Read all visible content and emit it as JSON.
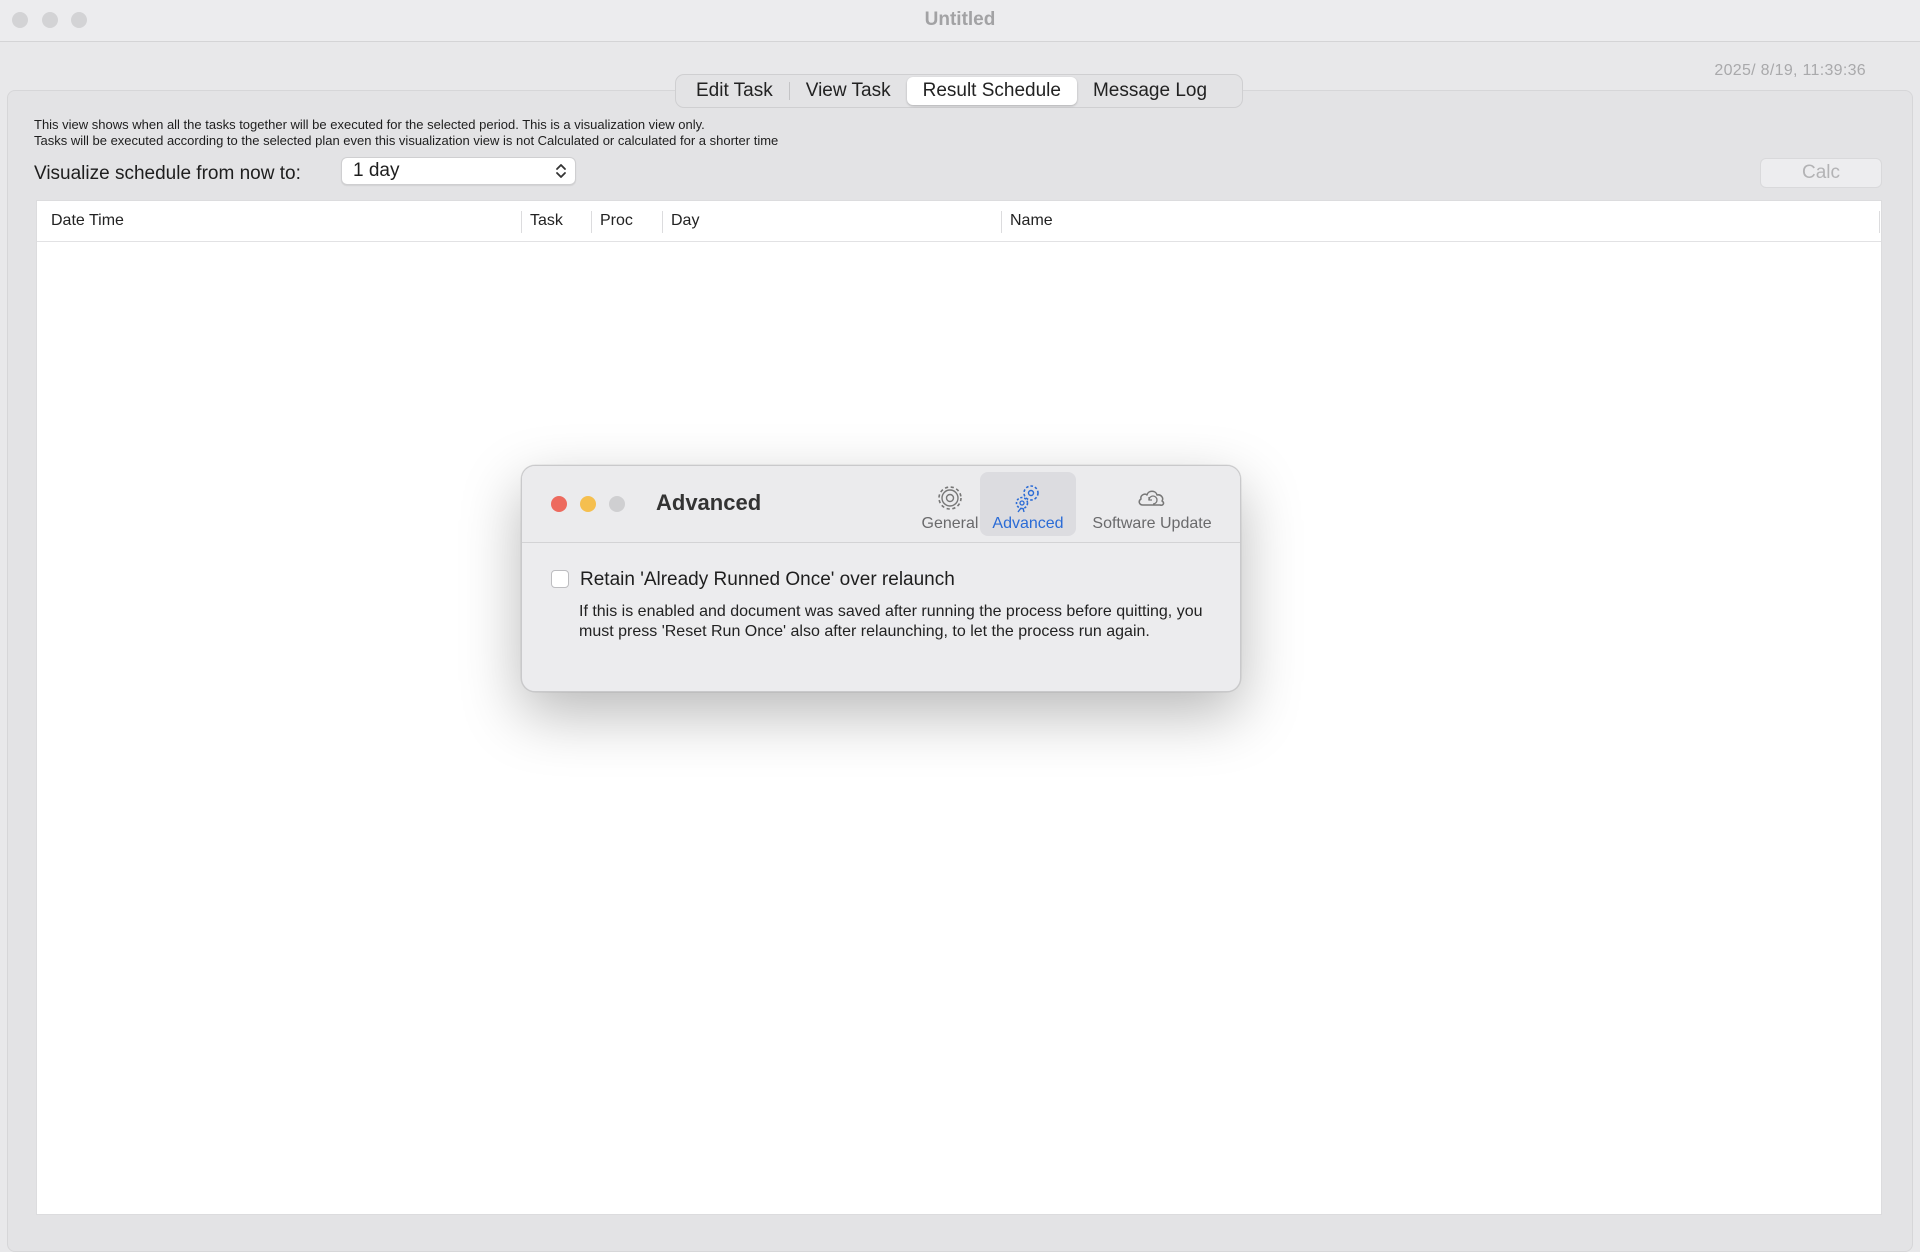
{
  "window": {
    "title": "Untitled",
    "datetime": "2025/  8/19, 11:39:36"
  },
  "tabs": [
    {
      "label": "Edit Task"
    },
    {
      "label": "View Task"
    },
    {
      "label": "Result Schedule",
      "active": true
    },
    {
      "label": "Message Log"
    }
  ],
  "description": {
    "line1": "This view shows when all the tasks together will be executed for the selected period. This is a visualization view only.",
    "line2": "Tasks will be executed according to the selected plan even this visualization view is not Calculated or calculated for a shorter time"
  },
  "visualize": {
    "label": "Visualize schedule from now to:",
    "selected": "1 day"
  },
  "calc_label": "Calc",
  "table": {
    "columns": [
      "Date Time",
      "Task",
      "Proc",
      "Day",
      "Name"
    ],
    "rows": []
  },
  "dialog": {
    "title": "Advanced",
    "tabs": [
      {
        "label": "General",
        "icon": "gear-icon"
      },
      {
        "label": "Advanced",
        "icon": "advanced-gears-icon",
        "selected": true
      },
      {
        "label": "Software Update",
        "icon": "cloud-update-icon"
      }
    ],
    "checkbox_label": "Retain 'Already Runned Once' over relaunch",
    "checkbox_checked": false,
    "help_text": "If this is enabled and document was saved after running the process before quitting, you must press 'Reset Run Once' also after relaunching, to let the process run again."
  },
  "colors": {
    "close": "#ed6a5e",
    "minimize": "#f5bf4f",
    "zoom_inactive": "#cfcfd1",
    "accent": "#2a6bd6"
  }
}
